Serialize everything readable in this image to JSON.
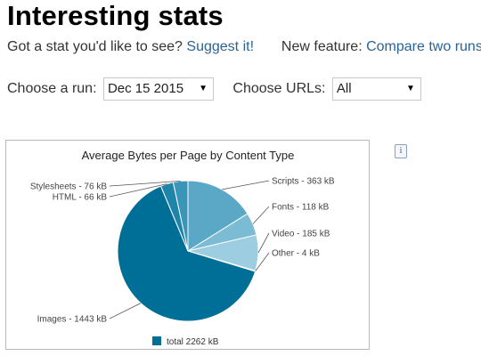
{
  "header": {
    "title": "Interesting stats",
    "suggest_prompt": "Got a stat you'd like to see?",
    "suggest_link": "Suggest it!",
    "feature_prompt": "New feature:",
    "feature_link": "Compare two runs"
  },
  "controls": {
    "run_label": "Choose a run:",
    "run_value": "Dec 15 2015",
    "urls_label": "Choose URLs:",
    "urls_value": "All",
    "info_glyph": "i"
  },
  "colors": {
    "images": "#006f98",
    "html": "#1e84aa",
    "stylesheets": "#3a95b8",
    "scripts": "#5aa8c6",
    "fonts": "#7bbbd3",
    "video": "#9dcde0",
    "other": "#c0e0ec"
  },
  "chart_data": {
    "type": "pie",
    "title": "Average Bytes per Page by Content Type",
    "slices": [
      {
        "name": "Scripts",
        "value": 363,
        "label": "Scripts - 363 kB",
        "color_key": "scripts"
      },
      {
        "name": "Fonts",
        "value": 118,
        "label": "Fonts - 118 kB",
        "color_key": "fonts"
      },
      {
        "name": "Video",
        "value": 185,
        "label": "Video - 185 kB",
        "color_key": "video"
      },
      {
        "name": "Other",
        "value": 4,
        "label": "Other - 4 kB",
        "color_key": "other"
      },
      {
        "name": "Images",
        "value": 1443,
        "label": "Images - 1443 kB",
        "color_key": "images"
      },
      {
        "name": "HTML",
        "value": 66,
        "label": "HTML - 66 kB",
        "color_key": "html"
      },
      {
        "name": "Stylesheets",
        "value": 76,
        "label": "Stylesheets - 76 kB",
        "color_key": "stylesheets"
      }
    ],
    "unit": "kB",
    "legend": "total 2262 kB",
    "legend_position": "bottom"
  }
}
